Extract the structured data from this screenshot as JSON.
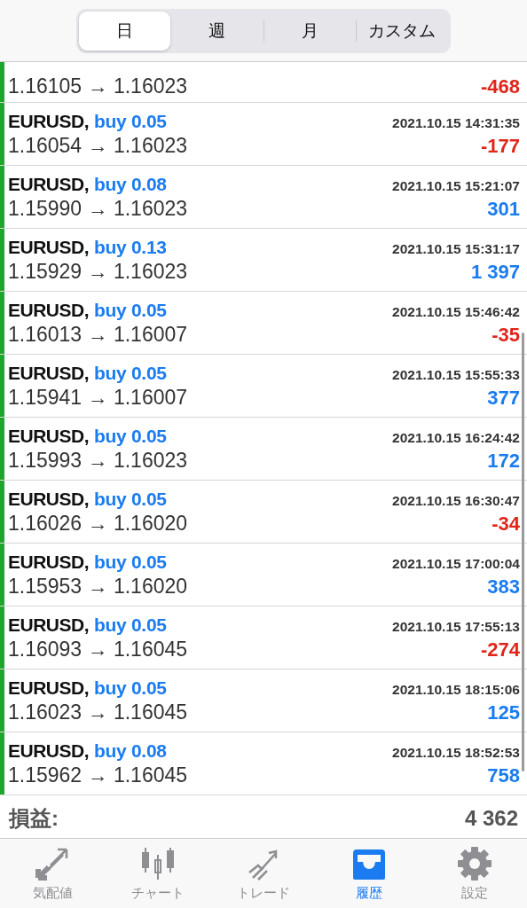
{
  "segments": [
    {
      "label": "日",
      "selected": true
    },
    {
      "label": "週",
      "selected": false
    },
    {
      "label": "月",
      "selected": false
    },
    {
      "label": "カスタム",
      "selected": false
    }
  ],
  "deals": [
    {
      "kind": "cut",
      "prices": "1.16105 → 1.16023",
      "profit": "-468",
      "color": "#e0261b"
    },
    {
      "kind": "full",
      "symbol": "EURUSD,",
      "side": "buy 0.05",
      "time": "2021.10.15 14:31:35",
      "prices": "1.16054 → 1.16023",
      "profit": "-177",
      "color": "#e0261b"
    },
    {
      "kind": "full",
      "symbol": "EURUSD,",
      "side": "buy 0.08",
      "time": "2021.10.15 15:21:07",
      "prices": "1.15990 → 1.16023",
      "profit": "301",
      "color": "#1a7cf0"
    },
    {
      "kind": "full",
      "symbol": "EURUSD,",
      "side": "buy 0.13",
      "time": "2021.10.15 15:31:17",
      "prices": "1.15929 → 1.16023",
      "profit": "1 397",
      "color": "#1a7cf0"
    },
    {
      "kind": "full",
      "symbol": "EURUSD,",
      "side": "buy 0.05",
      "time": "2021.10.15 15:46:42",
      "prices": "1.16013 → 1.16007",
      "profit": "-35",
      "color": "#e0261b"
    },
    {
      "kind": "full",
      "symbol": "EURUSD,",
      "side": "buy 0.05",
      "time": "2021.10.15 15:55:33",
      "prices": "1.15941 → 1.16007",
      "profit": "377",
      "color": "#1a7cf0"
    },
    {
      "kind": "full",
      "symbol": "EURUSD,",
      "side": "buy 0.05",
      "time": "2021.10.15 16:24:42",
      "prices": "1.15993 → 1.16023",
      "profit": "172",
      "color": "#1a7cf0"
    },
    {
      "kind": "full",
      "symbol": "EURUSD,",
      "side": "buy 0.05",
      "time": "2021.10.15 16:30:47",
      "prices": "1.16026 → 1.16020",
      "profit": "-34",
      "color": "#e0261b"
    },
    {
      "kind": "full",
      "symbol": "EURUSD,",
      "side": "buy 0.05",
      "time": "2021.10.15 17:00:04",
      "prices": "1.15953 → 1.16020",
      "profit": "383",
      "color": "#1a7cf0"
    },
    {
      "kind": "full",
      "symbol": "EURUSD,",
      "side": "buy 0.05",
      "time": "2021.10.15 17:55:13",
      "prices": "1.16093 → 1.16045",
      "profit": "-274",
      "color": "#e0261b"
    },
    {
      "kind": "full",
      "symbol": "EURUSD,",
      "side": "buy 0.05",
      "time": "2021.10.15 18:15:06",
      "prices": "1.16023 → 1.16045",
      "profit": "125",
      "color": "#1a7cf0"
    },
    {
      "kind": "full",
      "symbol": "EURUSD,",
      "side": "buy 0.08",
      "time": "2021.10.15 18:52:53",
      "prices": "1.15962 → 1.16045",
      "profit": "758",
      "color": "#1a7cf0"
    }
  ],
  "summary": {
    "label": "損益:",
    "value": "4 362"
  },
  "tab_bar": [
    {
      "kind": "quotes",
      "label": "気配値",
      "selected": false
    },
    {
      "kind": "chart",
      "label": "チャート",
      "selected": false
    },
    {
      "kind": "trade",
      "label": "トレード",
      "selected": false
    },
    {
      "kind": "history",
      "label": "履歴",
      "selected": true
    },
    {
      "kind": "settings",
      "label": "設定",
      "selected": false
    }
  ]
}
